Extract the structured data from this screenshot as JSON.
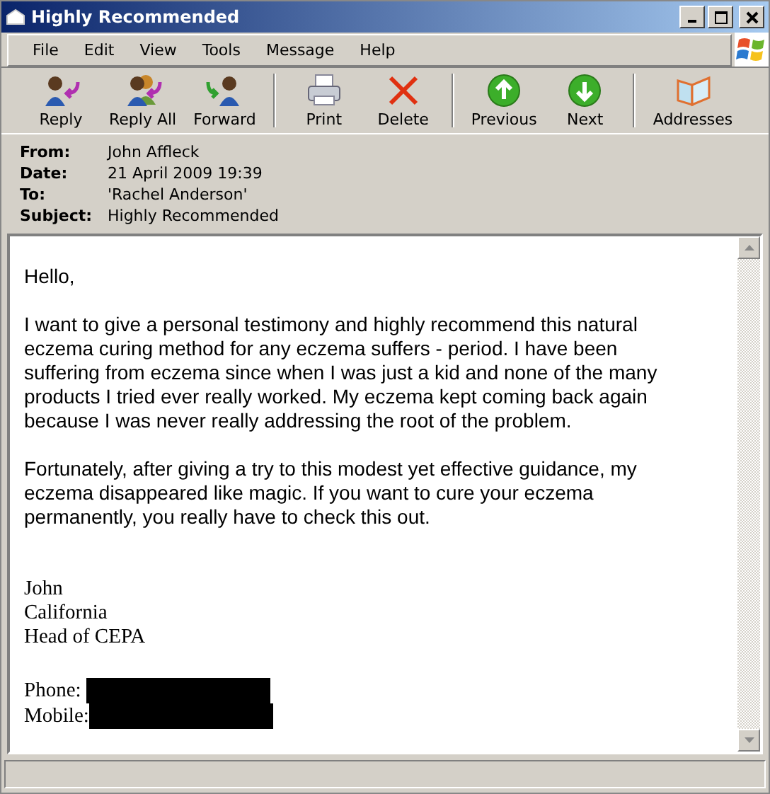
{
  "window": {
    "title": "Highly Recommended"
  },
  "menu": [
    "File",
    "Edit",
    "View",
    "Tools",
    "Message",
    "Help"
  ],
  "toolbar": [
    [
      "Reply",
      "Reply All",
      "Forward"
    ],
    [
      "Print",
      "Delete"
    ],
    [
      "Previous",
      "Next"
    ],
    [
      "Addresses"
    ]
  ],
  "headers": [
    {
      "label": "From:",
      "value": "John Affleck"
    },
    {
      "label": "Date:",
      "value": "21 April 2009 19:39"
    },
    {
      "label": "To:",
      "value": "'Rachel Anderson'"
    },
    {
      "label": "Subject:",
      "value": "Highly Recommended"
    }
  ],
  "body": {
    "greeting": "Hello,",
    "paragraphs": [
      "I want to give a personal testimony and highly recommend this natural eczema curing method for any eczema suffers - period. I have been suffering from eczema since when I was just a kid and none of the many products I tried ever really worked. My eczema kept coming back again because I was never really addressing the root of the problem.",
      "Fortunately, after giving a try to this modest yet effective guidance, my eczema disappeared like magic. If you want to cure your eczema permanently, you really have to check this out."
    ],
    "signature": [
      "John",
      "California",
      "Head of CEPA"
    ],
    "contacts": [
      {
        "label": "Phone:"
      },
      {
        "label": "Mobile:"
      }
    ]
  }
}
